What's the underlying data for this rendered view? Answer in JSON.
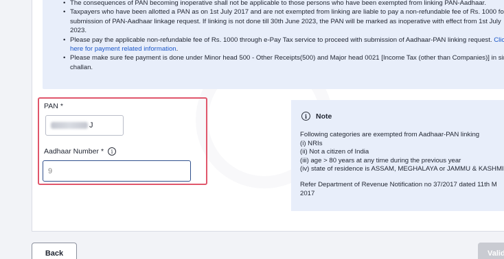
{
  "info_bullets": [
    {
      "lines": [
        "The consequences of PAN becoming inoperative shall not be applicable to those persons who have been exempted from linking PAN-Aadhaar."
      ]
    },
    {
      "lines": [
        "Taxpayers who have been allotted a PAN as on 1st July 2017 and are not exempted from linking are liable to pay a non-refundable fee of Rs. 1000 for",
        "submission of PAN-Aadhaar linkage request. If linking is not done till 30th June 2023, the PAN will be marked as inoperative with effect from 1st July",
        "2023."
      ]
    },
    {
      "text_before_link": "Please pay the applicable non-refundable fee of Rs. 1000 through e-Pay Tax service to proceed with submission of Aadhaar-PAN linking request.",
      "link_part1": "Click",
      "link_part2": "here for payment related information",
      "after_link": "."
    },
    {
      "lines": [
        "Please make sure fee payment is done under Minor head 500 - Other Receipts(500) and Major head 0021 [Income Tax (other than Companies)] in singl",
        "challan."
      ]
    }
  ],
  "form": {
    "pan_label": "PAN",
    "pan_required": "*",
    "pan_value_visible": "J",
    "aadhaar_label": "Aadhaar Number",
    "aadhaar_required": "*",
    "aadhaar_value_visible": "9",
    "info_icon_glyph": "i"
  },
  "note": {
    "icon_glyph": "i",
    "title": "Note",
    "intro": "Following categories are exempted from Aadhaar-PAN linking",
    "items": [
      "(i) NRIs",
      "(ii) Not a citizen of India",
      "(iii) age > 80 years at any time during the previous year",
      "(iv) state of residence is ASSAM, MEGHALAYA or JAMMU & KASHMI"
    ],
    "ref_lines": [
      "Refer Department of Revenue Notification no 37/2017 dated 11th M",
      "2017"
    ]
  },
  "buttons": {
    "back": "Back",
    "validate": "Valid"
  },
  "colors": {
    "highlight_border": "#e0566b",
    "link": "#1a56c8",
    "info_bg": "#e8eefa"
  }
}
